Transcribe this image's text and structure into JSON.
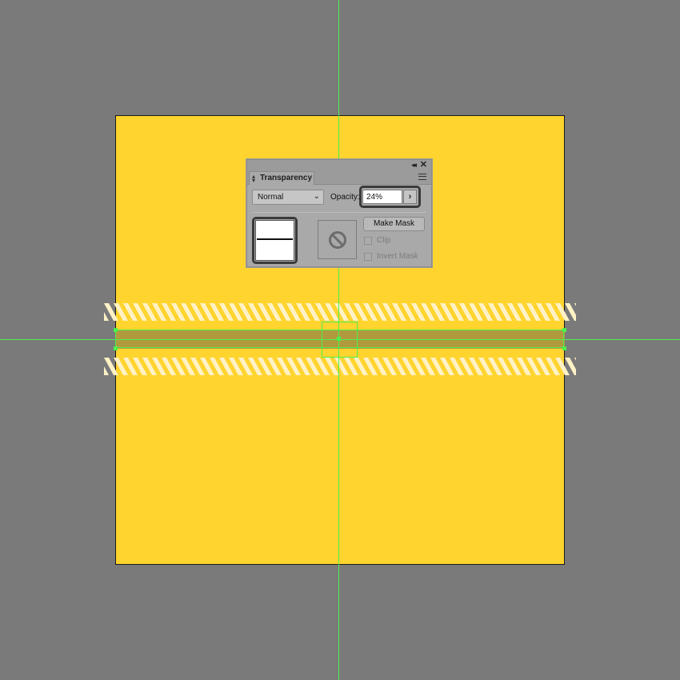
{
  "canvas": {
    "background": "#7a7a7a",
    "artboard_color": "#ffd42f",
    "guide_color": "#4cf04c",
    "bar_color": "#b19a3d",
    "stripe_color": "#fff2c6"
  },
  "transparency_panel": {
    "title": "Transparency",
    "collapse_icon": "double-chevron-left-icon",
    "close_icon": "close-icon",
    "menu_icon": "panel-menu-icon",
    "blend_mode": "Normal",
    "opacity_label": "Opacity:",
    "opacity_value": "24%",
    "make_mask_label": "Make Mask",
    "clip_label": "Clip",
    "invert_mask_label": "Invert Mask",
    "clip_checked": false,
    "invert_mask_checked": false
  }
}
